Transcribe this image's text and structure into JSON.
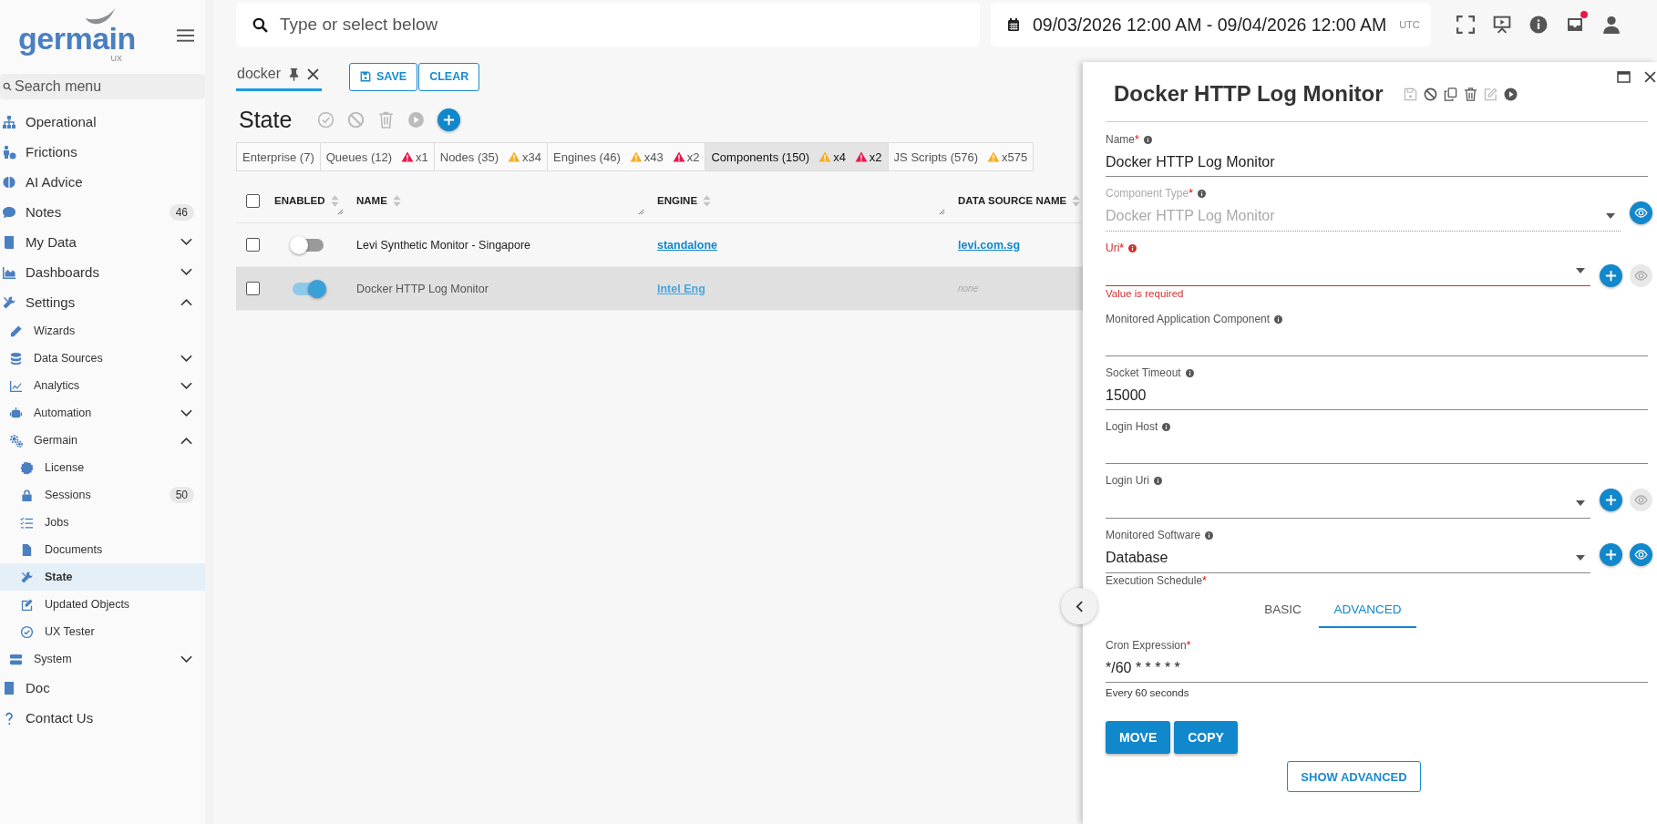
{
  "logo": {
    "wordmark": "germain",
    "suffix": "UX"
  },
  "sidebar": {
    "search": {
      "placeholder": "Search menu"
    },
    "items": [
      {
        "label": "Operational",
        "selected": false
      },
      {
        "label": "Frictions",
        "selected": false
      },
      {
        "label": "AI Advice",
        "selected": false
      },
      {
        "label": "Notes",
        "badge": "46",
        "selected": false
      },
      {
        "label": "My Data",
        "selected": false,
        "expanded": false
      },
      {
        "label": "Dashboards",
        "selected": false,
        "expanded": false
      },
      {
        "label": "Settings",
        "selected": false,
        "expanded": true,
        "children": [
          {
            "label": "Wizards",
            "selected": false
          },
          {
            "label": "Data Sources",
            "selected": false,
            "expanded": false
          },
          {
            "label": "Analytics",
            "selected": false,
            "expanded": false
          },
          {
            "label": "Automation",
            "selected": false,
            "expanded": false
          },
          {
            "label": "Germain",
            "selected": false,
            "expanded": true,
            "children": [
              {
                "label": "License",
                "selected": false
              },
              {
                "label": "Sessions",
                "badge": "50",
                "selected": false
              },
              {
                "label": "Jobs",
                "selected": false
              },
              {
                "label": "Documents",
                "selected": false
              },
              {
                "label": "State",
                "selected": true
              },
              {
                "label": "Updated Objects",
                "selected": false
              },
              {
                "label": "UX Tester",
                "selected": false
              }
            ]
          },
          {
            "label": "System",
            "selected": false,
            "expanded": false
          }
        ]
      },
      {
        "label": "Doc",
        "selected": false
      },
      {
        "label": "Contact Us",
        "selected": false
      }
    ]
  },
  "topbar": {
    "search": {
      "placeholder": "Type or select below"
    },
    "date_range": "09/03/2026 12:00 AM - 09/04/2026 12:00 AM",
    "timezone": "UTC",
    "notification": true
  },
  "filter": {
    "chip": "docker",
    "buttons": [
      {
        "kind": "save",
        "label": "SAVE"
      },
      {
        "kind": "plain",
        "label": "CLEAR"
      }
    ]
  },
  "page": {
    "title": "State"
  },
  "tabs": [
    {
      "label": "Enterprise (7)",
      "selected": false
    },
    {
      "label": "Queues (12)",
      "selected": false,
      "alerts": [
        {
          "kind": "error",
          "count": "x1"
        }
      ]
    },
    {
      "label": "Nodes (35)",
      "selected": false,
      "alerts": [
        {
          "kind": "warning",
          "count": "x34"
        }
      ]
    },
    {
      "label": "Engines (46)",
      "selected": false,
      "alerts": [
        {
          "kind": "warning",
          "count": "x43"
        },
        {
          "kind": "error",
          "count": "x2"
        }
      ]
    },
    {
      "label": "Components (150)",
      "selected": true,
      "alerts": [
        {
          "kind": "warning",
          "count": "x4"
        },
        {
          "kind": "error",
          "count": "x2"
        }
      ]
    },
    {
      "label": "JS Scripts (576)",
      "selected": false,
      "alerts": [
        {
          "kind": "warning",
          "count": "x575"
        }
      ]
    }
  ],
  "table": {
    "all_checked": false,
    "columns": [
      "ENABLED",
      "NAME",
      "ENGINE",
      "DATA SOURCE NAME"
    ],
    "rows": [
      {
        "checked": false,
        "selected": false,
        "enabled": false,
        "name": "Levi Synthetic Monitor - Singapore",
        "engine": "standalone",
        "data_source": {
          "kind": "link",
          "text": "levi.com.sg"
        }
      },
      {
        "checked": false,
        "selected": true,
        "enabled": true,
        "name": "Docker HTTP Log Monitor",
        "engine": "Intel Eng",
        "data_source": {
          "kind": "empty",
          "text": "none"
        }
      }
    ]
  },
  "panel": {
    "title": "Docker HTTP Log Monitor",
    "required_mark": "*",
    "fields": [
      {
        "kind": "text",
        "label": "Name",
        "required": true,
        "disabled": false,
        "value": "Docker HTTP Log Monitor"
      },
      {
        "kind": "select",
        "label": "Component Type",
        "required": true,
        "disabled": true,
        "value": "Docker HTTP Log Monitor",
        "actions": [
          {
            "kind": "view",
            "disabled": false
          }
        ]
      },
      {
        "kind": "select",
        "label": "Uri",
        "required": true,
        "disabled": false,
        "error": "Value is required",
        "actions": [
          {
            "kind": "add",
            "disabled": false
          },
          {
            "kind": "view",
            "disabled": true
          }
        ]
      },
      {
        "kind": "text",
        "label": "Monitored Application Component",
        "required": false,
        "disabled": false
      },
      {
        "kind": "text",
        "label": "Socket Timeout",
        "required": false,
        "disabled": false,
        "value": "15000"
      },
      {
        "kind": "text",
        "label": "Login Host",
        "required": false,
        "disabled": false
      },
      {
        "kind": "select",
        "label": "Login Uri",
        "required": false,
        "disabled": false,
        "actions": [
          {
            "kind": "add",
            "disabled": false
          },
          {
            "kind": "view",
            "disabled": true
          }
        ]
      },
      {
        "kind": "select",
        "label": "Monitored Software",
        "required": false,
        "disabled": false,
        "value": "Database",
        "actions": [
          {
            "kind": "add",
            "disabled": false
          },
          {
            "kind": "view",
            "disabled": false
          }
        ]
      }
    ],
    "schedule": {
      "label": "Execution Schedule",
      "required": true,
      "tabs": [
        {
          "label": "BASIC",
          "selected": false
        },
        {
          "label": "ADVANCED",
          "selected": true
        }
      ],
      "cron": {
        "label": "Cron Expression",
        "required": true,
        "value": "*/60 * * * * *",
        "hint": "Every 60 seconds"
      }
    },
    "buttons": [
      "MOVE",
      "COPY"
    ],
    "footer_button": "SHOW ADVANCED"
  }
}
